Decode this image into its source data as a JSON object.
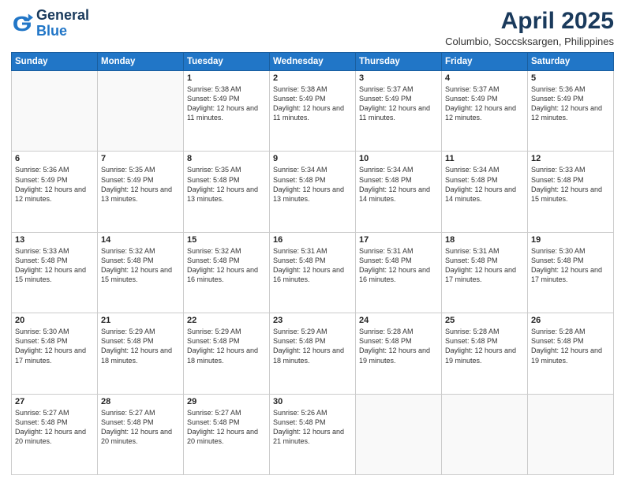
{
  "header": {
    "logo_general": "General",
    "logo_blue": "Blue",
    "title": "April 2025",
    "location": "Columbio, Soccsksargen, Philippines"
  },
  "weekdays": [
    "Sunday",
    "Monday",
    "Tuesday",
    "Wednesday",
    "Thursday",
    "Friday",
    "Saturday"
  ],
  "weeks": [
    [
      {
        "day": "",
        "info": ""
      },
      {
        "day": "",
        "info": ""
      },
      {
        "day": "1",
        "info": "Sunrise: 5:38 AM\nSunset: 5:49 PM\nDaylight: 12 hours and 11 minutes."
      },
      {
        "day": "2",
        "info": "Sunrise: 5:38 AM\nSunset: 5:49 PM\nDaylight: 12 hours and 11 minutes."
      },
      {
        "day": "3",
        "info": "Sunrise: 5:37 AM\nSunset: 5:49 PM\nDaylight: 12 hours and 11 minutes."
      },
      {
        "day": "4",
        "info": "Sunrise: 5:37 AM\nSunset: 5:49 PM\nDaylight: 12 hours and 12 minutes."
      },
      {
        "day": "5",
        "info": "Sunrise: 5:36 AM\nSunset: 5:49 PM\nDaylight: 12 hours and 12 minutes."
      }
    ],
    [
      {
        "day": "6",
        "info": "Sunrise: 5:36 AM\nSunset: 5:49 PM\nDaylight: 12 hours and 12 minutes."
      },
      {
        "day": "7",
        "info": "Sunrise: 5:35 AM\nSunset: 5:49 PM\nDaylight: 12 hours and 13 minutes."
      },
      {
        "day": "8",
        "info": "Sunrise: 5:35 AM\nSunset: 5:48 PM\nDaylight: 12 hours and 13 minutes."
      },
      {
        "day": "9",
        "info": "Sunrise: 5:34 AM\nSunset: 5:48 PM\nDaylight: 12 hours and 13 minutes."
      },
      {
        "day": "10",
        "info": "Sunrise: 5:34 AM\nSunset: 5:48 PM\nDaylight: 12 hours and 14 minutes."
      },
      {
        "day": "11",
        "info": "Sunrise: 5:34 AM\nSunset: 5:48 PM\nDaylight: 12 hours and 14 minutes."
      },
      {
        "day": "12",
        "info": "Sunrise: 5:33 AM\nSunset: 5:48 PM\nDaylight: 12 hours and 15 minutes."
      }
    ],
    [
      {
        "day": "13",
        "info": "Sunrise: 5:33 AM\nSunset: 5:48 PM\nDaylight: 12 hours and 15 minutes."
      },
      {
        "day": "14",
        "info": "Sunrise: 5:32 AM\nSunset: 5:48 PM\nDaylight: 12 hours and 15 minutes."
      },
      {
        "day": "15",
        "info": "Sunrise: 5:32 AM\nSunset: 5:48 PM\nDaylight: 12 hours and 16 minutes."
      },
      {
        "day": "16",
        "info": "Sunrise: 5:31 AM\nSunset: 5:48 PM\nDaylight: 12 hours and 16 minutes."
      },
      {
        "day": "17",
        "info": "Sunrise: 5:31 AM\nSunset: 5:48 PM\nDaylight: 12 hours and 16 minutes."
      },
      {
        "day": "18",
        "info": "Sunrise: 5:31 AM\nSunset: 5:48 PM\nDaylight: 12 hours and 17 minutes."
      },
      {
        "day": "19",
        "info": "Sunrise: 5:30 AM\nSunset: 5:48 PM\nDaylight: 12 hours and 17 minutes."
      }
    ],
    [
      {
        "day": "20",
        "info": "Sunrise: 5:30 AM\nSunset: 5:48 PM\nDaylight: 12 hours and 17 minutes."
      },
      {
        "day": "21",
        "info": "Sunrise: 5:29 AM\nSunset: 5:48 PM\nDaylight: 12 hours and 18 minutes."
      },
      {
        "day": "22",
        "info": "Sunrise: 5:29 AM\nSunset: 5:48 PM\nDaylight: 12 hours and 18 minutes."
      },
      {
        "day": "23",
        "info": "Sunrise: 5:29 AM\nSunset: 5:48 PM\nDaylight: 12 hours and 18 minutes."
      },
      {
        "day": "24",
        "info": "Sunrise: 5:28 AM\nSunset: 5:48 PM\nDaylight: 12 hours and 19 minutes."
      },
      {
        "day": "25",
        "info": "Sunrise: 5:28 AM\nSunset: 5:48 PM\nDaylight: 12 hours and 19 minutes."
      },
      {
        "day": "26",
        "info": "Sunrise: 5:28 AM\nSunset: 5:48 PM\nDaylight: 12 hours and 19 minutes."
      }
    ],
    [
      {
        "day": "27",
        "info": "Sunrise: 5:27 AM\nSunset: 5:48 PM\nDaylight: 12 hours and 20 minutes."
      },
      {
        "day": "28",
        "info": "Sunrise: 5:27 AM\nSunset: 5:48 PM\nDaylight: 12 hours and 20 minutes."
      },
      {
        "day": "29",
        "info": "Sunrise: 5:27 AM\nSunset: 5:48 PM\nDaylight: 12 hours and 20 minutes."
      },
      {
        "day": "30",
        "info": "Sunrise: 5:26 AM\nSunset: 5:48 PM\nDaylight: 12 hours and 21 minutes."
      },
      {
        "day": "",
        "info": ""
      },
      {
        "day": "",
        "info": ""
      },
      {
        "day": "",
        "info": ""
      }
    ]
  ]
}
